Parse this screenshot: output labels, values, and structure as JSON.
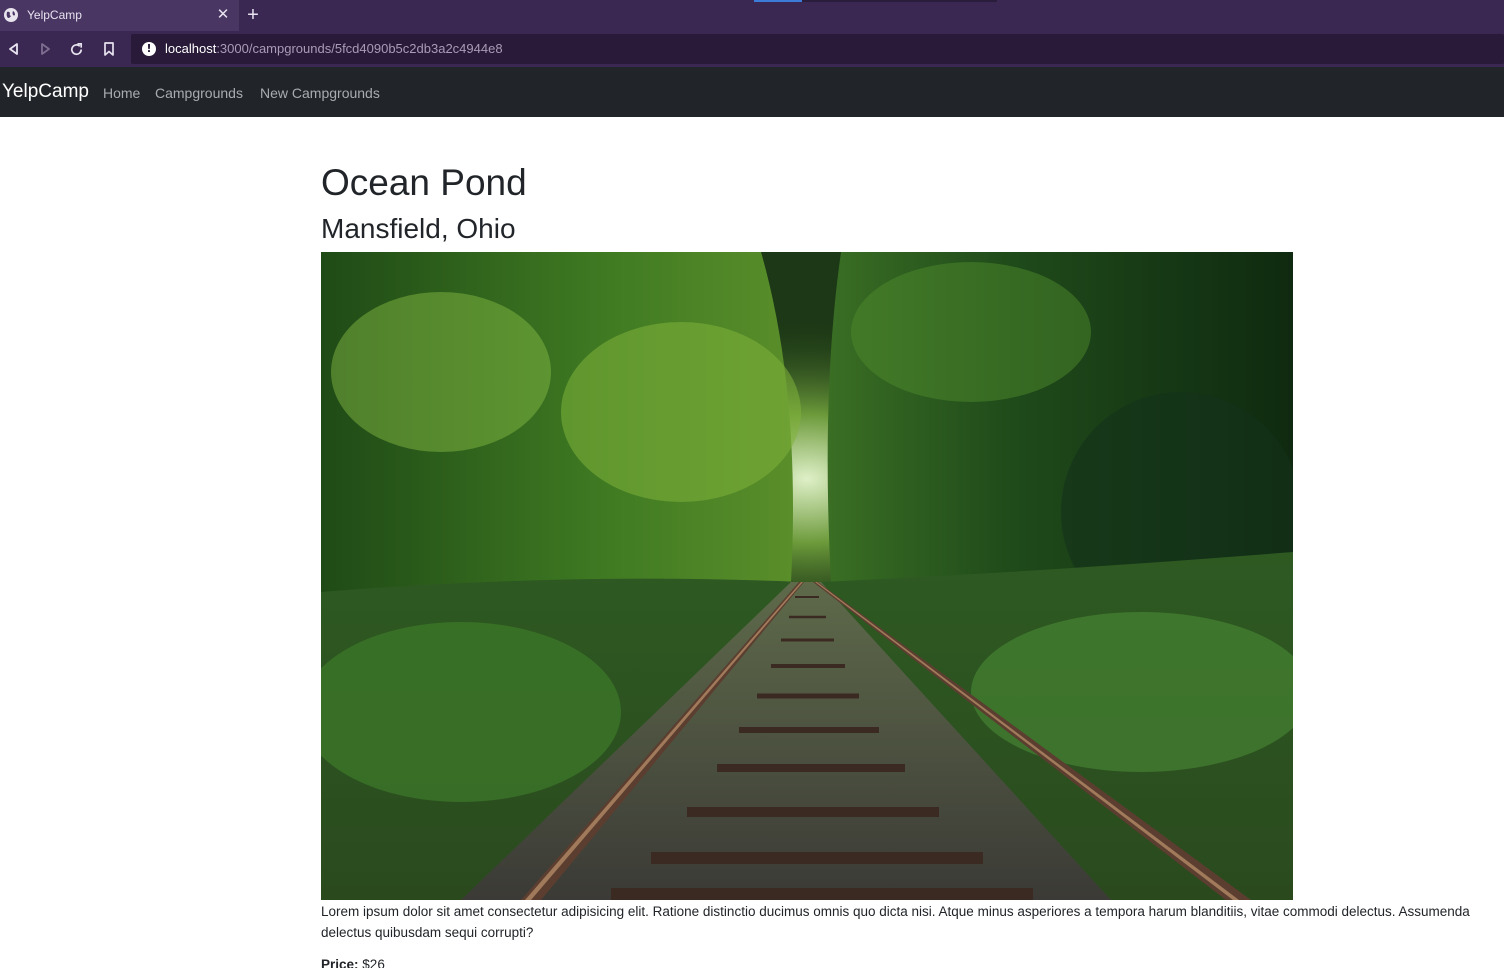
{
  "browser": {
    "tab_title": "YelpCamp",
    "close_glyph": "✕",
    "new_tab_glyph": "+",
    "url_host": "localhost",
    "url_rest": ":3000/campgrounds/5fcd4090b5c2db3a2c4944e8",
    "info_glyph": "!"
  },
  "navbar": {
    "brand": "YelpCamp",
    "links": [
      "Home",
      "Campgrounds",
      "New Campgrounds"
    ]
  },
  "campground": {
    "title": "Ocean Pond",
    "location": "Mansfield, Ohio",
    "image_alt_icon": "forest-railway-photo",
    "description": "Lorem ipsum dolor sit amet consectetur adipisicing elit. Ratione distinctio ducimus omnis quo dicta nisi. Atque minus asperiores a tempora harum blanditiis, vitae commodi delectus. Assumenda delectus quibusdam sequi corrupti?",
    "price_label": "Price:",
    "price_value": "$26"
  },
  "colors": {
    "browser_chrome": "#3b2852",
    "urlbar": "#281a38",
    "navbar": "#212529",
    "nav_link": "#a8acb0"
  }
}
